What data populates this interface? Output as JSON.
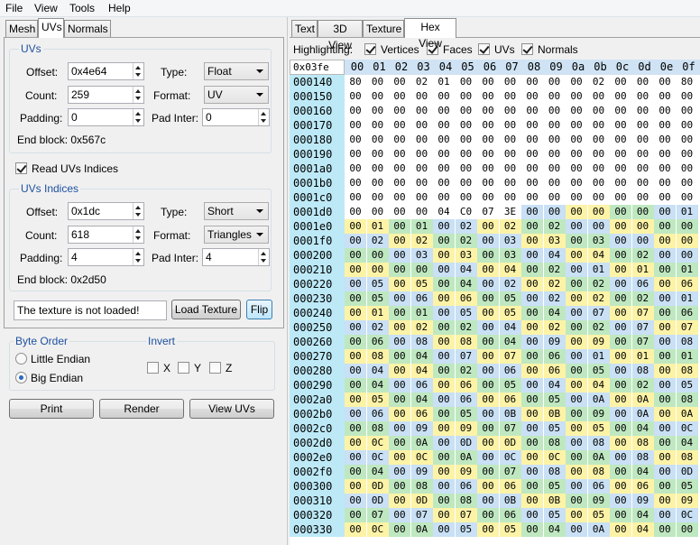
{
  "menu": [
    "File",
    "View",
    "Tools",
    "Help"
  ],
  "left_tabs": [
    "Mesh",
    "UVs",
    "Normals"
  ],
  "uvs_group": {
    "title": "UVs",
    "offset_label": "Offset:",
    "offset_value": "0x4e64",
    "count_label": "Count:",
    "count_value": "259",
    "padding_label": "Padding:",
    "padding_value": "0",
    "type_label": "Type:",
    "type_value": "Float",
    "format_label": "Format:",
    "format_value": "UV",
    "padinter_label": "Pad Inter:",
    "padinter_value": "0",
    "end_block": "End block: 0x567c"
  },
  "read_indices": {
    "label": "Read UVs Indices",
    "checked": true
  },
  "indices_group": {
    "title": "UVs Indices",
    "offset_label": "Offset:",
    "offset_value": "0x1dc",
    "count_label": "Count:",
    "count_value": "618",
    "padding_label": "Padding:",
    "padding_value": "4",
    "type_label": "Type:",
    "type_value": "Short",
    "format_label": "Format:",
    "format_value": "Triangles",
    "padinter_label": "Pad Inter:",
    "padinter_value": "4",
    "end_block": "End block: 0x2d50"
  },
  "texture": {
    "status": "The texture is not loaded!",
    "load_label": "Load Texture",
    "flip_label": "Flip"
  },
  "byte_order": {
    "title": "Byte Order",
    "little": "Little Endian",
    "big": "Big Endian",
    "selected": "big"
  },
  "invert": {
    "title": "Invert",
    "x": "X",
    "y": "Y",
    "z": "Z"
  },
  "buttons": {
    "print": "Print",
    "render": "Render",
    "view_uvs": "View UVs"
  },
  "right_tabs": [
    "Text",
    "3D View",
    "Texture",
    "Hex View"
  ],
  "highlighting": {
    "label": "Highlighting:",
    "options": [
      {
        "label": "Vertices",
        "checked": true
      },
      {
        "label": "Faces",
        "checked": true
      },
      {
        "label": "UVs",
        "checked": true
      },
      {
        "label": "Normals",
        "checked": true
      }
    ]
  },
  "hex": {
    "cursor": "0x03fe",
    "columns": [
      "00",
      "01",
      "02",
      "03",
      "04",
      "05",
      "06",
      "07",
      "08",
      "09",
      "0a",
      "0b",
      "0c",
      "0d",
      "0e",
      "0f"
    ],
    "colors": {
      "a": "#c9e0f5",
      "b": "#bfe8c1",
      "c": "#fdf3a7",
      "addr": "#bde9f7"
    },
    "rows": [
      {
        "addr": "000140",
        "bytes": "80 00 00 02 01 00 00 00 00 00 00 02 00 00 00 80"
      },
      {
        "addr": "000150",
        "bytes": "00 00 00 00 00 00 00 00 00 00 00 00 00 00 00 00"
      },
      {
        "addr": "000160",
        "bytes": "00 00 00 00 00 00 00 00 00 00 00 00 00 00 00 00"
      },
      {
        "addr": "000170",
        "bytes": "00 00 00 00 00 00 00 00 00 00 00 00 00 00 00 00"
      },
      {
        "addr": "000180",
        "bytes": "00 00 00 00 00 00 00 00 00 00 00 00 00 00 00 00"
      },
      {
        "addr": "000190",
        "bytes": "00 00 00 00 00 00 00 00 00 00 00 00 00 00 00 00"
      },
      {
        "addr": "0001a0",
        "bytes": "00 00 00 00 00 00 00 00 00 00 00 00 00 00 00 00"
      },
      {
        "addr": "0001b0",
        "bytes": "00 00 00 00 00 00 00 00 00 00 00 00 00 00 00 00"
      },
      {
        "addr": "0001c0",
        "bytes": "00 00 00 00 00 00 00 00 00 00 00 00 00 00 00 00"
      },
      {
        "addr": "0001d0",
        "bytes": "00 00 00 00 04 C0 07 3E 00 00 00 00 00 00 00 01"
      },
      {
        "addr": "0001e0",
        "bytes": "00 01 00 01 00 02 00 02 00 02 00 00 00 00 00 00"
      },
      {
        "addr": "0001f0",
        "bytes": "00 02 00 02 00 02 00 03 00 03 00 03 00 00 00 00"
      },
      {
        "addr": "000200",
        "bytes": "00 00 00 03 00 03 00 03 00 04 00 04 00 02 00 00"
      },
      {
        "addr": "000210",
        "bytes": "00 00 00 00 00 04 00 04 00 02 00 01 00 01 00 01"
      },
      {
        "addr": "000220",
        "bytes": "00 05 00 05 00 04 00 02 00 02 00 02 00 06 00 06"
      },
      {
        "addr": "000230",
        "bytes": "00 05 00 06 00 06 00 05 00 02 00 02 00 02 00 01"
      },
      {
        "addr": "000240",
        "bytes": "00 01 00 01 00 05 00 05 00 04 00 07 00 07 00 06"
      },
      {
        "addr": "000250",
        "bytes": "00 02 00 02 00 02 00 04 00 02 00 02 00 07 00 07"
      },
      {
        "addr": "000260",
        "bytes": "00 06 00 08 00 08 00 04 00 09 00 09 00 07 00 08"
      },
      {
        "addr": "000270",
        "bytes": "00 08 00 04 00 07 00 07 00 06 00 01 00 01 00 01"
      },
      {
        "addr": "000280",
        "bytes": "00 04 00 04 00 02 00 06 00 06 00 05 00 08 00 08"
      },
      {
        "addr": "000290",
        "bytes": "00 04 00 06 00 06 00 05 00 04 00 04 00 02 00 05"
      },
      {
        "addr": "0002a0",
        "bytes": "00 05 00 04 00 06 00 06 00 05 00 0A 00 0A 00 08"
      },
      {
        "addr": "0002b0",
        "bytes": "00 06 00 06 00 05 00 0B 00 0B 00 09 00 0A 00 0A"
      },
      {
        "addr": "0002c0",
        "bytes": "00 08 00 09 00 09 00 07 00 05 00 05 00 04 00 0C"
      },
      {
        "addr": "0002d0",
        "bytes": "00 0C 00 0A 00 0D 00 0D 00 08 00 08 00 08 00 04"
      },
      {
        "addr": "0002e0",
        "bytes": "00 0C 00 0C 00 0A 00 0C 00 0C 00 0A 00 08 00 08"
      },
      {
        "addr": "0002f0",
        "bytes": "00 04 00 09 00 09 00 07 00 08 00 08 00 04 00 0D"
      },
      {
        "addr": "000300",
        "bytes": "00 0D 00 08 00 06 00 06 00 05 00 06 00 06 00 05"
      },
      {
        "addr": "000310",
        "bytes": "00 0D 00 0D 00 08 00 0B 00 0B 00 09 00 09 00 09"
      },
      {
        "addr": "000320",
        "bytes": "00 07 00 07 00 07 00 06 00 05 00 05 00 04 00 0C"
      },
      {
        "addr": "000330",
        "bytes": "00 0C 00 0A 00 05 00 05 00 04 00 0A 00 04 00 00"
      }
    ]
  }
}
